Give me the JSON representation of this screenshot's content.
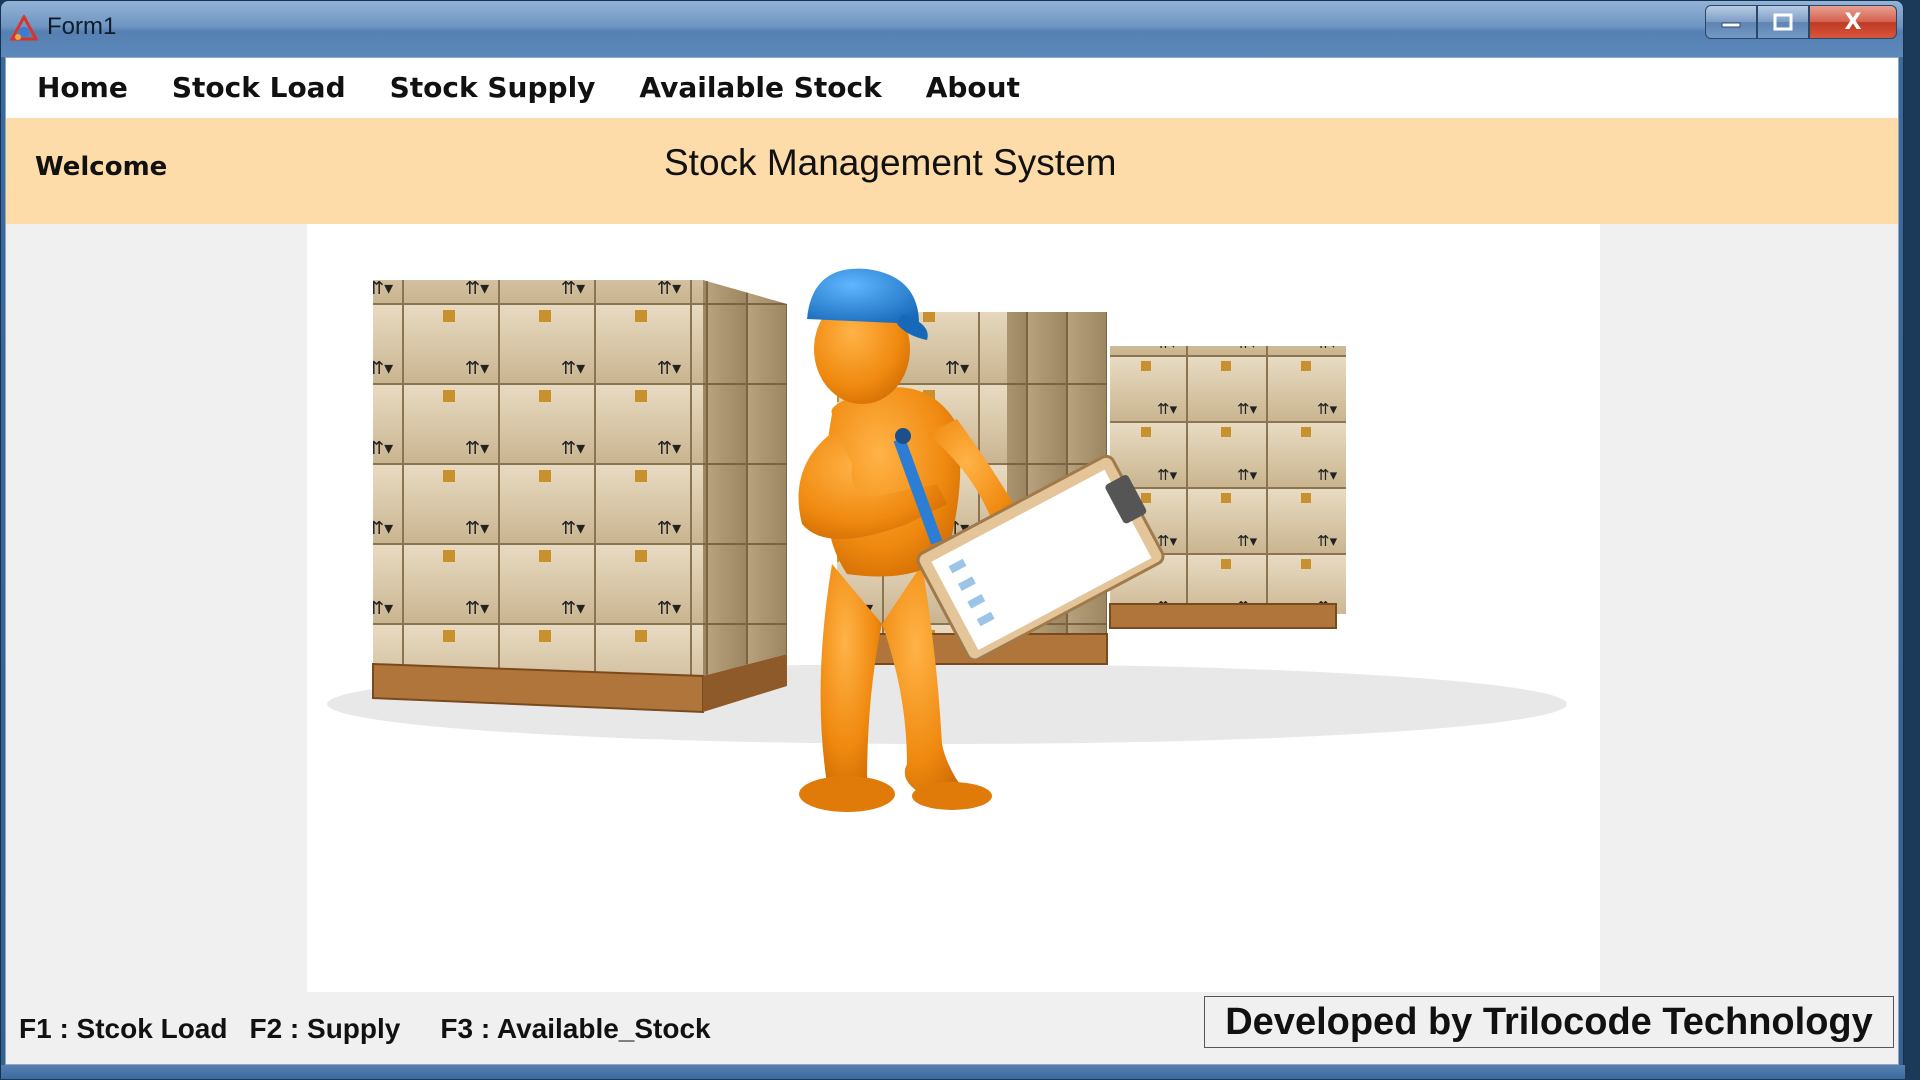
{
  "window": {
    "title": "Form1",
    "icon": "app-logo-icon",
    "controls": {
      "minimize_icon": "minimize-icon",
      "maximize_icon": "maximize-icon",
      "close_label": "X"
    }
  },
  "menu": {
    "items": [
      {
        "label": "Home"
      },
      {
        "label": "Stock Load"
      },
      {
        "label": "Stock Supply"
      },
      {
        "label": "Available Stock"
      },
      {
        "label": "About"
      }
    ]
  },
  "banner": {
    "welcome": "Welcome",
    "title": "Stock Management System",
    "background": "#fddcaa"
  },
  "illustration": {
    "semantic": "warehouse-worker-with-clipboard-illustration"
  },
  "footer": {
    "shortcut_1": "F1 : Stcok Load",
    "shortcut_2": "F2 : Supply",
    "shortcut_3": "F3 : Available_Stock",
    "developer": "Developed by Trilocode Technology"
  }
}
